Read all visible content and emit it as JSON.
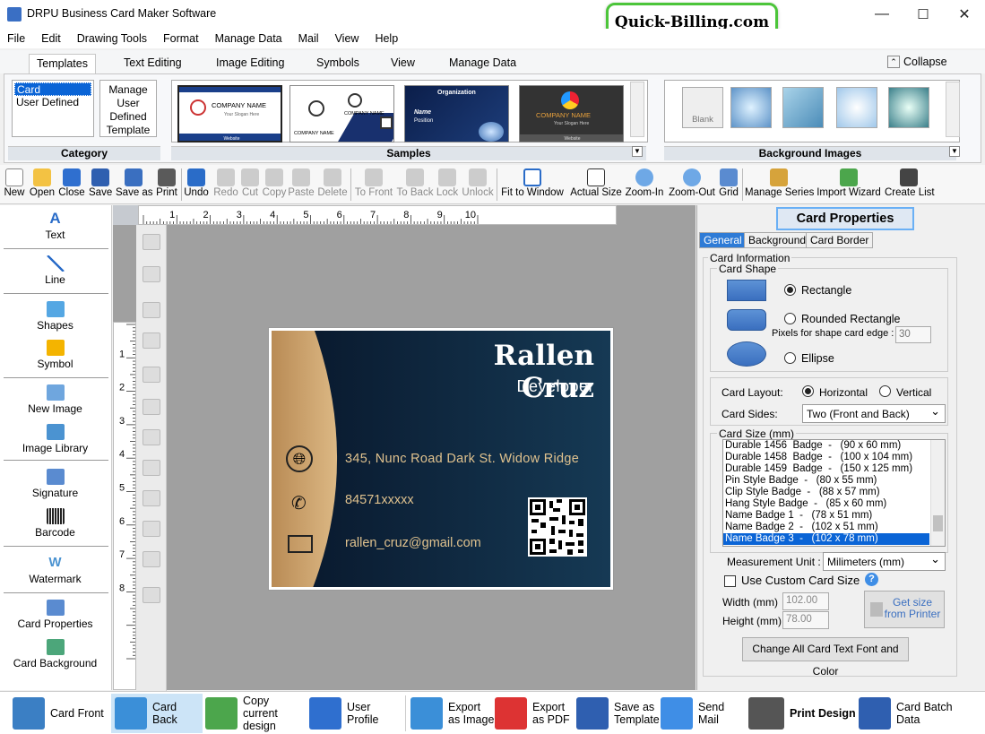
{
  "window": {
    "title": "DRPU Business Card Maker Software",
    "minimize": "—",
    "maximize": "☐",
    "close": "✕"
  },
  "banner": "Quick-Billing.com",
  "menu": [
    "File",
    "Edit",
    "Drawing Tools",
    "Format",
    "Manage Data",
    "Mail",
    "View",
    "Help"
  ],
  "ribbon_tabs": [
    "Templates",
    "Text Editing",
    "Image Editing",
    "Symbols",
    "View",
    "Manage Data"
  ],
  "collapse": "Collapse",
  "category": {
    "label": "Category",
    "items": [
      "Card Templates",
      "User Defined"
    ],
    "manage": "Manage User Defined Template"
  },
  "samples": {
    "label": "Samples",
    "items": [
      {
        "name": "COMPANY NAME",
        "slogan": "Your Slogan Here",
        "website": "Website"
      },
      {
        "name": "COMPANY NAME",
        "sub": "COMPANY NAME"
      },
      {
        "name": "Organization",
        "line1": "Name",
        "line2": "Position"
      },
      {
        "name": "COMPANY NAME",
        "slogan": "Your Slogan Here",
        "website": "Website"
      }
    ]
  },
  "background_images": {
    "label": "Background Images",
    "blank": "Blank"
  },
  "toolbar": [
    "New",
    "Open",
    "Close",
    "Save",
    "Save as",
    "Print",
    "Undo",
    "Redo",
    "Cut",
    "Copy",
    "Paste",
    "Delete",
    "To Front",
    "To Back",
    "Lock",
    "Unlock",
    "Fit to Window",
    "Actual Size",
    "Zoom-In",
    "Zoom-Out",
    "Grid",
    "Manage Series",
    "Import Wizard",
    "Create List"
  ],
  "left_tools": [
    "Text",
    "Line",
    "Shapes",
    "Symbol",
    "New Image",
    "Image Library",
    "Signature",
    "Barcode",
    "Watermark",
    "Card Properties",
    "Card Background"
  ],
  "ruler": {
    "h": [
      "1",
      "2",
      "3",
      "4",
      "5",
      "6",
      "7",
      "8",
      "9",
      "10"
    ],
    "v": [
      "1",
      "2",
      "3",
      "4",
      "5",
      "6",
      "7",
      "8"
    ]
  },
  "card": {
    "name": "Rallen Cruz",
    "title": "Developer",
    "address": "345, Nunc Road Dark St. Widow Ridge",
    "phone": "84571xxxxx",
    "email": "rallen_cruz@gmail.com",
    "colors": {
      "bg": "#11293f",
      "accent": "#c9a06a"
    }
  },
  "props": {
    "title": "Card Properties",
    "tabs": [
      "General",
      "Background",
      "Card Border"
    ],
    "card_information": "Card Information",
    "card_shape": "Card Shape",
    "shapes": [
      "Rectangle",
      "Rounded Rectangle",
      "Ellipse"
    ],
    "pixels_label": "Pixels for shape card edge :",
    "pixels_value": "30",
    "layout_label": "Card Layout:",
    "layout_options": [
      "Horizontal",
      "Vertical"
    ],
    "sides_label": "Card Sides:",
    "sides_value": "Two (Front and Back)",
    "size_label": "Card Size (mm)",
    "sizes": [
      "Durable 1456  Badge  -   (90 x 60 mm)",
      "Durable 1458  Badge  -   (100 x 104 mm)",
      "Durable 1459  Badge  -   (150 x 125 mm)",
      "Pin Style Badge  -   (80 x 55 mm)",
      "Clip Style Badge  -   (88 x 57 mm)",
      "Hang Style Badge  -   (85 x 60 mm)",
      "Name Badge 1  -   (78 x 51 mm)",
      "Name Badge 2  -   (102 x 51 mm)",
      "Name Badge 3  -   (102 x 78 mm)"
    ],
    "measure_label": "Measurement Unit :",
    "measure_value": "Milimeters (mm)",
    "custom_size": "Use Custom Card Size",
    "width_label": "Width   (mm)",
    "width_value": "102.00",
    "height_label": "Height  (mm)",
    "height_value": "78.00",
    "get_size": "Get size from Printer",
    "change_font": "Change All Card Text Font and Color"
  },
  "bottom": [
    "Card Front",
    "Card Back",
    "Copy current design",
    "User Profile",
    "Export as Image",
    "Export as PDF",
    "Save as Template",
    "Send Mail",
    "Print Design",
    "Card Batch Data"
  ]
}
